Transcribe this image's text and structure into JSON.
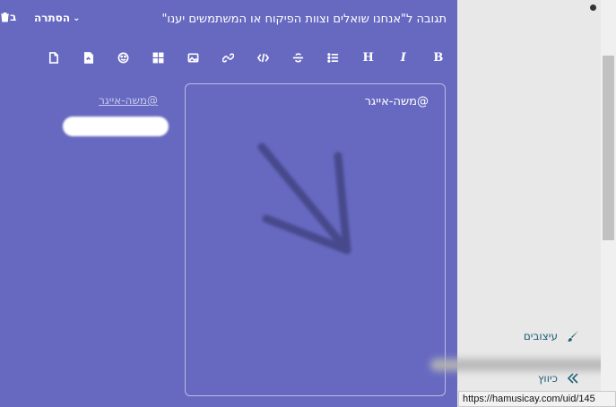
{
  "composer": {
    "reply_title": "תגובה ל\"אנחנו שואלים וצוות הפיקוח או המשתמשים יענו\"",
    "hide_label": "הסתרה",
    "discard_label": "ב",
    "background_color": "#6769c1",
    "toolbar": [
      {
        "name": "bold",
        "icon": "B"
      },
      {
        "name": "italic",
        "icon": "I"
      },
      {
        "name": "heading",
        "icon": "H"
      },
      {
        "name": "list",
        "icon": "list-icon"
      },
      {
        "name": "strikethrough",
        "icon": "strikethrough-icon"
      },
      {
        "name": "code",
        "icon": "code-icon"
      },
      {
        "name": "link",
        "icon": "link-icon"
      },
      {
        "name": "image",
        "icon": "image-icon"
      },
      {
        "name": "qr",
        "icon": "qr-icon"
      },
      {
        "name": "emoji",
        "icon": "emoji-icon"
      },
      {
        "name": "pdf",
        "icon": "pdf-icon"
      },
      {
        "name": "file",
        "icon": "file-icon"
      }
    ],
    "editor_text": "@משה-אייגר",
    "preview_link": "@משה-אייגר"
  },
  "sidebar": {
    "items": [
      {
        "label": "עיצובים",
        "icon": "brush-icon"
      },
      {
        "label": "כיווץ",
        "icon": "double-chevron-icon"
      }
    ],
    "link_color": "#1c5e74"
  },
  "status_bar": {
    "url": "https://hamusicay.com/uid/145"
  }
}
